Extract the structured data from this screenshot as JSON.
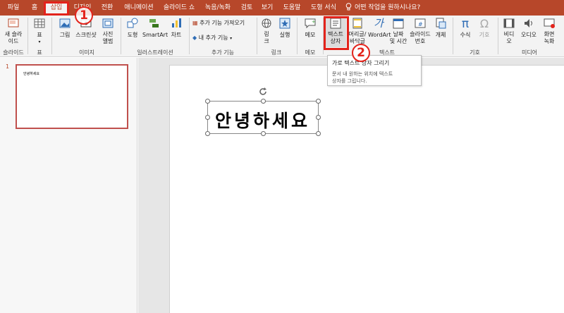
{
  "tabs": [
    {
      "label": "파일",
      "active": false
    },
    {
      "label": "홈",
      "active": false
    },
    {
      "label": "삽입",
      "active": true
    },
    {
      "label": "디자인",
      "active": false
    },
    {
      "label": "전환",
      "active": false
    },
    {
      "label": "애니메이션",
      "active": false
    },
    {
      "label": "슬라이드 쇼",
      "active": false
    },
    {
      "label": "녹음/녹화",
      "active": false
    },
    {
      "label": "검토",
      "active": false
    },
    {
      "label": "보기",
      "active": false
    },
    {
      "label": "도움말",
      "active": false
    },
    {
      "label": "도형 서식",
      "active": false
    }
  ],
  "tell_me": "어떤 작업을 원하시나요?",
  "ribbon": {
    "new_slide": "새 슬라\n이드",
    "table": "표",
    "pictures": "그림",
    "screenshot": "스크린샷",
    "photo_album": "사진\n앨범",
    "shapes": "도형",
    "smartart": "SmartArt",
    "chart": "차트",
    "get_addins": "추가 기능 가져오기",
    "my_addins": "내 추가 기능",
    "link": "링\n크",
    "action": "실행",
    "comment": "메모",
    "textbox": "텍스트\n상자",
    "header_footer": "머리글/\n바닥글",
    "wordart": "WordArt",
    "date_time": "날짜\n및 시간",
    "slide_number": "슬라이드\n번호",
    "object": "개체",
    "equation": "수식",
    "symbol": "기호",
    "video": "비디\n오",
    "audio": "오디오",
    "screen_recording": "화면\n녹화",
    "groups": {
      "slides": "슬라이드",
      "tables": "표",
      "images": "이미지",
      "illustrations": "일러스트레이션",
      "addins": "추가 기능",
      "links": "링크",
      "comments": "메모",
      "text": "텍스트",
      "symbols": "기호",
      "media": "미디어"
    }
  },
  "tooltip": {
    "title": "가로 텍스트 상자 그리기",
    "description": "문서 내 원하는 위치에 텍스트\n상자를 그립니다."
  },
  "slides_panel": {
    "slide_number": "1",
    "thumbnail_text": "안녕하세요"
  },
  "slide": {
    "textbox_text": "안녕하세요"
  },
  "annotations": {
    "marker1": "1",
    "marker2": "2"
  },
  "colors": {
    "accent": "#b7472a",
    "annotation": "#e3231b"
  }
}
